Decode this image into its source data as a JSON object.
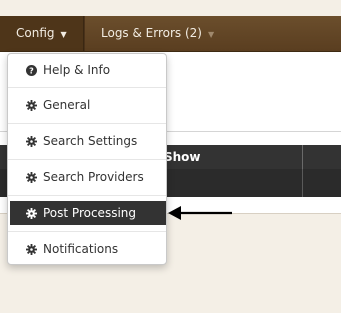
{
  "navbar": {
    "config": {
      "label": "Config",
      "icon": "caret-down-icon"
    },
    "logs": {
      "label": "Logs & Errors (2)",
      "icon": "caret-down-icon"
    }
  },
  "table": {
    "header_show": "Show"
  },
  "dropdown": {
    "items": [
      {
        "label": "Help & Info",
        "icon": "question-circle-icon"
      },
      {
        "label": "General",
        "icon": "gear-icon"
      },
      {
        "label": "Search Settings",
        "icon": "gear-icon"
      },
      {
        "label": "Search Providers",
        "icon": "gear-icon"
      },
      {
        "label": "Post Processing",
        "icon": "gear-icon",
        "active": true
      },
      {
        "label": "Notifications",
        "icon": "gear-icon"
      }
    ]
  },
  "colors": {
    "navbar": "#5a3e20",
    "active_item": "#333333",
    "page_bg": "#f4efe6"
  }
}
